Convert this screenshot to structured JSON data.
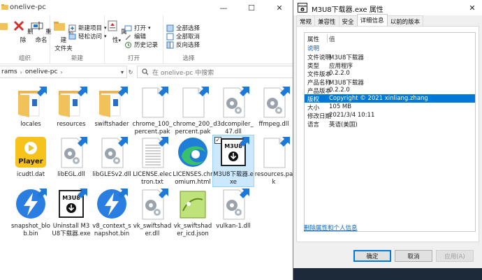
{
  "explorer": {
    "title": "onelive-pc",
    "ribbon": {
      "clipboard_label": "组织",
      "delete_label": "删除",
      "rename_label": "重命名",
      "new_group_label": "新建",
      "new_folder_label": "新建\n文件夹",
      "new_item_label": "新建项目",
      "easy_access_label": "轻松访问",
      "open_group_label": "打开",
      "properties_label": "属性",
      "open_label": "打开",
      "edit_label": "编辑",
      "history_label": "历史记录",
      "select_group_label": "选择",
      "select_all_label": "全部选择",
      "select_none_label": "全部取消",
      "invert_label": "反向选择"
    },
    "address": {
      "crumb_1": "rams",
      "crumb_2": "onelive-pc"
    },
    "search": {
      "placeholder": "在 onelive-pc 中搜索"
    },
    "files": [
      {
        "name": "locales",
        "type": "folder"
      },
      {
        "name": "resources",
        "type": "folder"
      },
      {
        "name": "swiftshader",
        "type": "folder"
      },
      {
        "name": "chrome_100_percent.pak",
        "type": "file"
      },
      {
        "name": "chrome_200_percent.pak",
        "type": "file"
      },
      {
        "name": "d3dcompiler_47.dll",
        "type": "dll"
      },
      {
        "name": "ffmpeg.dll",
        "type": "dll"
      },
      {
        "name": "icudtl.dat",
        "type": "player"
      },
      {
        "name": "libEGL.dll",
        "type": "dll"
      },
      {
        "name": "libGLESv2.dll",
        "type": "dll"
      },
      {
        "name": "LICENSE.electron.txt",
        "type": "txt"
      },
      {
        "name": "LICENSES.chromium.html",
        "type": "edge"
      },
      {
        "name": "M3U8下载器.exe",
        "type": "m3u8",
        "selected": true
      },
      {
        "name": "resources.pak",
        "type": "file"
      },
      {
        "name": "snapshot_blob.bin",
        "type": "bolt"
      },
      {
        "name": "Uninstall M3U8下载器.exe",
        "type": "m3u8"
      },
      {
        "name": "v8_context_snapshot.bin",
        "type": "bolt"
      },
      {
        "name": "vk_swiftshader.dll",
        "type": "dll"
      },
      {
        "name": "vk_swiftshader_icd.json",
        "type": "json"
      },
      {
        "name": "vulkan-1.dll",
        "type": "dll"
      }
    ],
    "player_badge": "Player",
    "m3u8_badge": "M3U8"
  },
  "props": {
    "title": "M3U8下载器.exe 属性",
    "tabs": [
      "常规",
      "兼容性",
      "安全",
      "详细信息",
      "以前的版本"
    ],
    "active_tab": 3,
    "header": {
      "k": "属性",
      "v": "值"
    },
    "section": "说明",
    "rows": [
      {
        "k": "文件说明",
        "v": "M3U8下载器"
      },
      {
        "k": "类型",
        "v": "应用程序"
      },
      {
        "k": "文件版本",
        "v": "0.2.2.0"
      },
      {
        "k": "产品名称",
        "v": "M3U8下载器"
      },
      {
        "k": "产品版本",
        "v": "0.2.2.0"
      },
      {
        "k": "版权",
        "v": "Copyright © 2021 xinliang.zhang"
      },
      {
        "k": "大小",
        "v": "105 MB"
      },
      {
        "k": "修改日期",
        "v": "2021/3/4 10:11"
      },
      {
        "k": "语言",
        "v": "英语(美国)"
      }
    ],
    "selected_row": 5,
    "link": "删除属性和个人信息",
    "ok": "确定",
    "cancel": "取消",
    "apply": "应用(A)"
  },
  "colors": {
    "accent": "#0078d7",
    "folder": "#f2c25a",
    "shortcut_arrow": "#1e78d6"
  }
}
